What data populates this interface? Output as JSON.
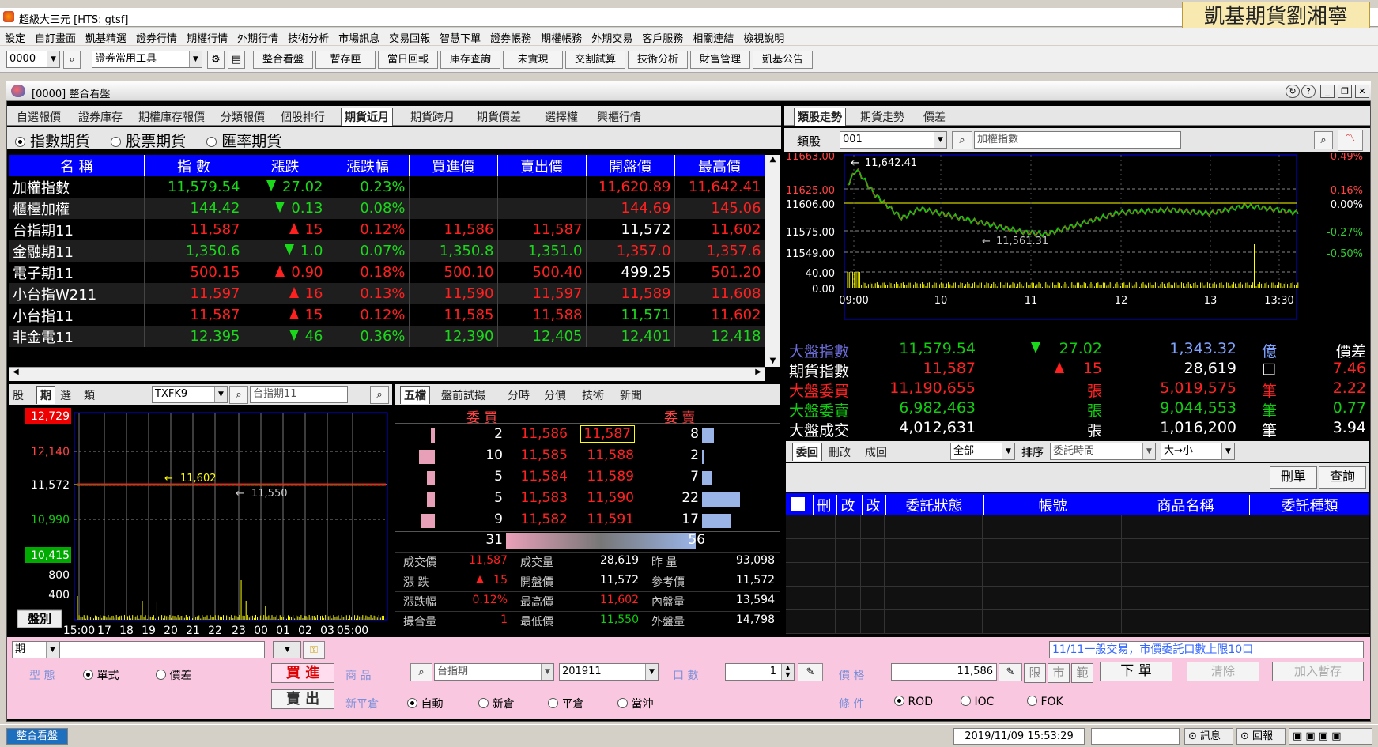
{
  "app": {
    "title": "超級大三元 [HTS: gtsf]",
    "brand": "凱基期貨劉湘寧"
  },
  "menu": [
    "設定",
    "自訂畫面",
    "凱基精選",
    "證券行情",
    "期權行情",
    "外期行情",
    "技術分析",
    "市場訊息",
    "交易回報",
    "智慧下單",
    "證券帳務",
    "期權帳務",
    "外期交易",
    "客戶服務",
    "相關連結",
    "檢視說明"
  ],
  "toolbar": {
    "code": "0000",
    "tool": "證券常用工具",
    "buttons": [
      "整合看盤",
      "暫存匣",
      "當日回報",
      "庫存查詢",
      "未實現",
      "交割試算",
      "技術分析",
      "財富管理",
      "凱基公告"
    ]
  },
  "window": {
    "title": "[0000] 整合看盤"
  },
  "tabs_main": [
    "自選報價",
    "證券庫存",
    "期權庫存報價",
    "分類報價",
    "個股排行",
    "期貨近月",
    "期貨跨月",
    "期貨價差",
    "選擇權",
    "興櫃行情"
  ],
  "tabs_right": [
    "類股走勢",
    "期貨走勢",
    "價差"
  ],
  "radios": [
    "指數期貨",
    "股票期貨",
    "匯率期貨"
  ],
  "quote": {
    "headers": [
      "名 稱",
      "指 數",
      "漲跌",
      "漲跌幅",
      "買進價",
      "賣出價",
      "開盤價",
      "最高價"
    ],
    "rows": [
      {
        "n": "加權指數",
        "idx": "11,579.54",
        "dir": "dn",
        "chg": "27.02",
        "pct": "0.23%",
        "bid": "",
        "ask": "",
        "open": "11,620.89",
        "high": "11,642.41",
        "ic": "g",
        "pc": "g",
        "bc": "r",
        "ac": "r",
        "oc": "r",
        "hc": "r"
      },
      {
        "n": "櫃檯加權",
        "idx": "144.42",
        "dir": "dn",
        "chg": "0.13",
        "pct": "0.08%",
        "bid": "",
        "ask": "",
        "open": "144.69",
        "high": "145.06",
        "ic": "g",
        "pc": "g",
        "bc": "r",
        "ac": "r",
        "oc": "r",
        "hc": "r"
      },
      {
        "n": "台指期11",
        "idx": "11,587",
        "dir": "up",
        "chg": "15",
        "pct": "0.12%",
        "bid": "11,586",
        "ask": "11,587",
        "open": "11,572",
        "high": "11,602",
        "ic": "r",
        "pc": "r",
        "bc": "r",
        "ac": "r",
        "oc": "w",
        "hc": "r"
      },
      {
        "n": "金融期11",
        "idx": "1,350.6",
        "dir": "dn",
        "chg": "1.0",
        "pct": "0.07%",
        "bid": "1,350.8",
        "ask": "1,351.0",
        "open": "1,357.0",
        "high": "1,357.6",
        "ic": "g",
        "pc": "g",
        "bc": "g",
        "ac": "g",
        "oc": "r",
        "hc": "r"
      },
      {
        "n": "電子期11",
        "idx": "500.15",
        "dir": "up",
        "chg": "0.90",
        "pct": "0.18%",
        "bid": "500.10",
        "ask": "500.40",
        "open": "499.25",
        "high": "501.20",
        "ic": "r",
        "pc": "r",
        "bc": "r",
        "ac": "r",
        "oc": "w",
        "hc": "r"
      },
      {
        "n": "小台指W211",
        "idx": "11,597",
        "dir": "up",
        "chg": "16",
        "pct": "0.13%",
        "bid": "11,590",
        "ask": "11,597",
        "open": "11,589",
        "high": "11,608",
        "ic": "r",
        "pc": "r",
        "bc": "r",
        "ac": "r",
        "oc": "r",
        "hc": "r"
      },
      {
        "n": "小台指11",
        "idx": "11,587",
        "dir": "up",
        "chg": "15",
        "pct": "0.12%",
        "bid": "11,585",
        "ask": "11,588",
        "open": "11,571",
        "high": "11,602",
        "ic": "r",
        "pc": "r",
        "bc": "r",
        "ac": "r",
        "oc": "g",
        "hc": "r"
      },
      {
        "n": "非金電11",
        "idx": "12,395",
        "dir": "dn",
        "chg": "46",
        "pct": "0.36%",
        "bid": "12,390",
        "ask": "12,405",
        "open": "12,401",
        "high": "12,418",
        "ic": "g",
        "pc": "g",
        "bc": "g",
        "ac": "g",
        "oc": "g",
        "hc": "g"
      }
    ]
  },
  "sector": {
    "label": "類股",
    "code": "001",
    "name": "加權指數",
    "y_left": [
      "11663.00",
      "11625.00",
      "11606.00",
      "11575.00",
      "11549.00",
      "40.00",
      "0.00"
    ],
    "y_right": [
      "0.49%",
      "0.16%",
      "0.00%",
      "-0.27%",
      "-0.50%"
    ],
    "x": [
      "09:00",
      "10",
      "11",
      "12",
      "13",
      "13:30"
    ],
    "hi_label": "11,642.41",
    "lo_label": "11,561.31"
  },
  "summary": [
    {
      "a": "大盤指數",
      "b": "11,579.54",
      "c": "27.02",
      "d": "1,343.32",
      "e": "億",
      "f": "價差"
    },
    {
      "a": "期貨指數",
      "b": "11,587",
      "c": "15",
      "d": "28,619",
      "e": "□",
      "f": "7.46"
    },
    {
      "a": "大盤委買",
      "b": "11,190,655",
      "c": "張",
      "d": "5,019,575",
      "e": "筆",
      "f": "2.22"
    },
    {
      "a": "大盤委賣",
      "b": "6,982,463",
      "c": "張",
      "d": "9,044,553",
      "e": "筆",
      "f": "0.77"
    },
    {
      "a": "大盤成交",
      "b": "4,012,631",
      "c": "張",
      "d": "1,016,200",
      "e": "筆",
      "f": "3.94"
    }
  ],
  "orders": {
    "tabs": [
      "委回",
      "刪改",
      "成回"
    ],
    "filter": "全部",
    "sort_label": "排序",
    "sort": "委託時間",
    "order": "大→小",
    "delete": "刪單",
    "query": "查詢",
    "headers": [
      "刪",
      "改",
      "改",
      "委託狀態",
      "帳號",
      "商品名稱",
      "委託種類"
    ]
  },
  "chartleft": {
    "tabs": [
      "股",
      "期",
      "選",
      "類"
    ],
    "code": "TXFK9",
    "name": "台指期11",
    "y": [
      "12,729",
      "12,140",
      "11,572",
      "10,990",
      "10,415",
      "800",
      "400"
    ],
    "x": [
      "15:00",
      "17",
      "18",
      "19",
      "20",
      "21",
      "22",
      "23",
      "00",
      "01",
      "02",
      "03",
      "05:00"
    ],
    "hi": "11,602",
    "lo": "11,550",
    "btn": "盤別"
  },
  "depth": {
    "tabs": [
      "五檔",
      "盤前試撮",
      "分時",
      "分價",
      "技術",
      "新聞"
    ],
    "buy": "委 買",
    "sell": "委 賣",
    "rows": [
      {
        "bq": "2",
        "bp": "11,586",
        "sp": "11,587",
        "sq": "8"
      },
      {
        "bq": "10",
        "bp": "11,585",
        "sp": "11,588",
        "sq": "2"
      },
      {
        "bq": "5",
        "bp": "11,584",
        "sp": "11,589",
        "sq": "7"
      },
      {
        "bq": "5",
        "bp": "11,583",
        "sp": "11,590",
        "sq": "22"
      },
      {
        "bq": "9",
        "bp": "11,582",
        "sp": "11,591",
        "sq": "17"
      }
    ],
    "tot_b": "31",
    "tot_s": "56",
    "stats": [
      [
        "成交價",
        "11,587",
        "成交量",
        "28,619",
        "昨 量",
        "93,098"
      ],
      [
        "漲 跌",
        "15",
        "開盤價",
        "11,572",
        "參考價",
        "11,572"
      ],
      [
        "漲跌幅",
        "0.12%",
        "最高價",
        "11,602",
        "內盤量",
        "13,594"
      ],
      [
        "撮合量",
        "1",
        "最低價",
        "11,550",
        "外盤量",
        "14,798"
      ]
    ]
  },
  "orderbar": {
    "prod_type": "期",
    "notice": "11/11一般交易，市價委託口數上限10口",
    "type_label": "型 態",
    "single": "單式",
    "spread": "價差",
    "buy": "買 進",
    "sell": "賣 出",
    "prod_label": "商 品",
    "product": "台指期",
    "month": "201911",
    "qty_label": "口 數",
    "qty": "1",
    "price_label": "價 格",
    "price": "11,586",
    "lim": "限",
    "mkt": "市",
    "rng": "範",
    "submit": "下 單",
    "clear": "清除",
    "stash": "加入暫存",
    "oc_label": "新平倉",
    "auto": "自動",
    "new": "新倉",
    "close": "平倉",
    "day": "當沖",
    "cond_label": "條 件",
    "rod": "ROD",
    "ioc": "IOC",
    "fok": "FOK"
  },
  "status": {
    "task": "整合看盤",
    "datetime": "2019/11/09 15:53:29",
    "msg": "訊息",
    "report": "回報"
  }
}
